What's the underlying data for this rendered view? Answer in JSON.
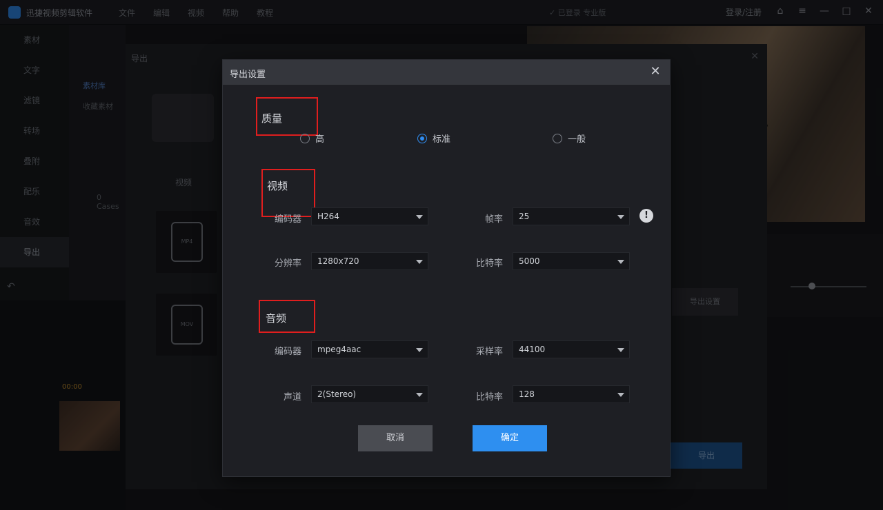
{
  "app": {
    "name": "迅捷视频剪辑软件",
    "menu": [
      "文件",
      "编辑",
      "视频",
      "帮助",
      "教程"
    ],
    "login_status": "✓ 已登录 专业版",
    "user": "登录/注册",
    "window_controls": [
      "⌂",
      "≡",
      "—",
      "□",
      "✕"
    ]
  },
  "sidebar": {
    "items": [
      {
        "label": "素材"
      },
      {
        "label": "文字"
      },
      {
        "label": "滤镜"
      },
      {
        "label": "转场"
      },
      {
        "label": "叠附"
      },
      {
        "label": "配乐"
      },
      {
        "label": "音效"
      },
      {
        "label": "导出"
      }
    ],
    "sub_active": "素材库",
    "sub_item": "收藏素材",
    "sub_count": "0 Cases"
  },
  "export_window": {
    "title": "导出",
    "tab": "视频",
    "file_card_1": "MP4",
    "file_card_2": "MOV",
    "export_button": "导出",
    "settings_button": "导出设置"
  },
  "timeline": {
    "clip_label": "00:00"
  },
  "dialog": {
    "title": "导出设置",
    "close": "✕",
    "quality": {
      "title": "质量",
      "options": [
        {
          "label": "高",
          "selected": false
        },
        {
          "label": "标准",
          "selected": true
        },
        {
          "label": "一般",
          "selected": false
        }
      ]
    },
    "video": {
      "title": "视频",
      "codec_label": "编码器",
      "codec_value": "H264",
      "framerate_label": "帧率",
      "framerate_value": "25",
      "resolution_label": "分辨率",
      "resolution_value": "1280x720",
      "bitrate_label": "比特率",
      "bitrate_value": "5000",
      "info_icon": "!"
    },
    "audio": {
      "title": "音频",
      "codec_label": "编码器",
      "codec_value": "mpeg4aac",
      "samplerate_label": "采样率",
      "samplerate_value": "44100",
      "channel_label": "声道",
      "channel_value": "2(Stereo)",
      "bitrate_label": "比特率",
      "bitrate_value": "128"
    },
    "cancel_label": "取消",
    "ok_label": "确定"
  },
  "colors": {
    "accent": "#2e8ff0",
    "highlight": "#e01e1e",
    "dialog_bg": "#1e1f24"
  }
}
